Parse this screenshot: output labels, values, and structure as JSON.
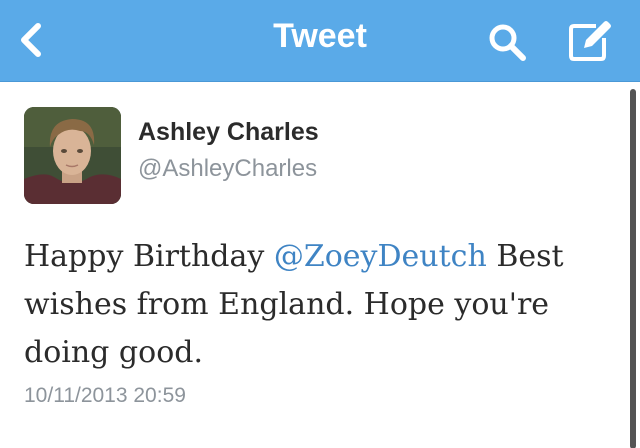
{
  "navbar": {
    "title": "Tweet",
    "back_icon": "chevron-left-icon",
    "search_icon": "search-icon",
    "compose_icon": "compose-icon",
    "background_color": "#5aaae8"
  },
  "tweet": {
    "author_name": "Ashley Charles",
    "author_handle": "@AshleyCharles",
    "text_before_mention": "Happy Birthday ",
    "mention": "@ZoeyDeutch",
    "text_after_mention": "  Best wishes from England. Hope you're doing good.",
    "timestamp": "10/11/2013 20:59",
    "mention_color": "#3f84c4"
  }
}
